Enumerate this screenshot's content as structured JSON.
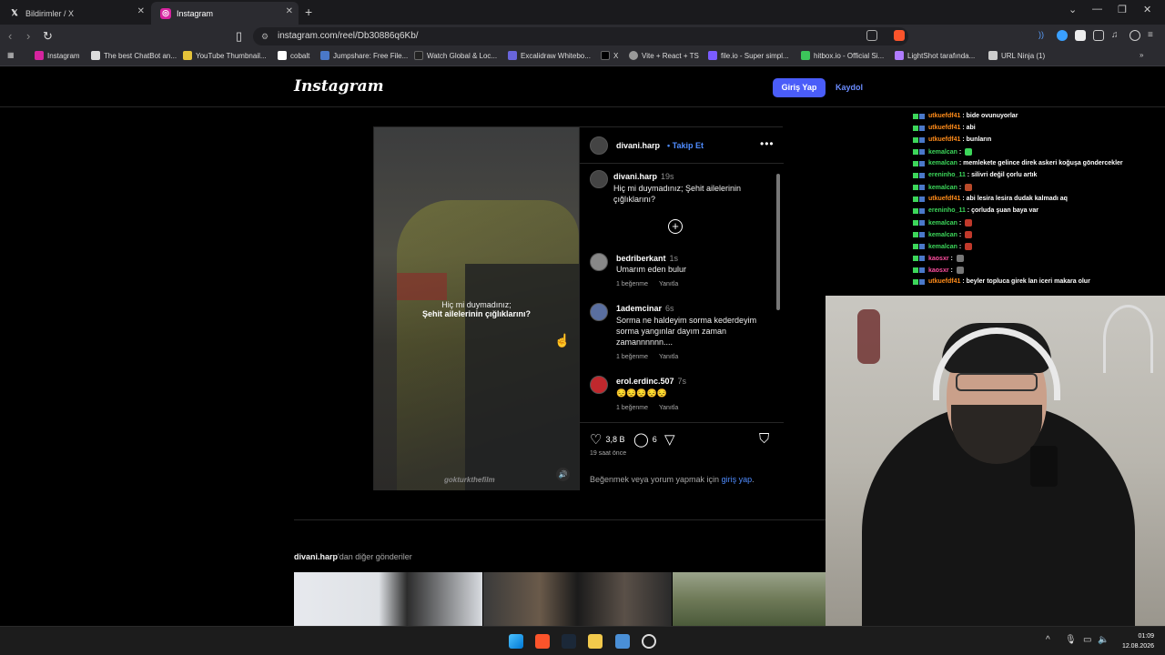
{
  "browser": {
    "tabs": [
      {
        "title": "Bildirimler / X",
        "icon": "x-logo-icon"
      },
      {
        "title": "Instagram",
        "icon": "instagram-icon",
        "active": true
      }
    ],
    "url": "instagram.com/reel/Db30886q6Kb/",
    "bookmarks": [
      {
        "label": "Instagram",
        "color": "#d6249f"
      },
      {
        "label": "The best ChatBot an...",
        "color": "#dddddd"
      },
      {
        "label": "YouTube Thumbnail...",
        "color": "#e5c33a"
      },
      {
        "label": "cobalt",
        "color": "#ffffff"
      },
      {
        "label": "Jumpshare: Free File...",
        "color": "#4a78c9"
      },
      {
        "label": "Watch Global & Loc...",
        "color": "#222222"
      },
      {
        "label": "Excalidraw Whitebo...",
        "color": "#6965db"
      },
      {
        "label": "X",
        "color": "#000000"
      },
      {
        "label": "Vite + React + TS",
        "color": "#999999"
      },
      {
        "label": "file.io - Super simpl...",
        "color": "#7a5cff"
      },
      {
        "label": "hitbox.io - Official Si...",
        "color": "#3cc45a"
      },
      {
        "label": "LightShot tarafında...",
        "color": "#b07cff"
      },
      {
        "label": "URL Ninja (1)",
        "color": "#cccccc"
      }
    ]
  },
  "header": {
    "logo": "Instagram",
    "login": "Giriş Yap",
    "signup": "Kaydol"
  },
  "post": {
    "author": "divani.harp",
    "follow": "Takip Et",
    "video_caption_line1": "Hiç mi duymadınız;",
    "video_caption_line2": "Şehit ailelerinin çığlıklarını?",
    "watermark": "gokturkthefilm",
    "caption": {
      "user": "divani.harp",
      "time": "19s",
      "text": "Hiç mi duymadınız; Şehit ailelerinin çığlıklarını?"
    },
    "comments": [
      {
        "user": "bedriberkant",
        "time": "1s",
        "text": "Umarım eden bulur",
        "likes": "1 beğenme",
        "reply": "Yanıtla"
      },
      {
        "user": "1ademcinar",
        "time": "6s",
        "text": "Sorma ne haldeyim sorma kederdeyim sorma yangınlar dayım zaman zamannnnnn....",
        "likes": "1 beğenme",
        "reply": "Yanıtla"
      },
      {
        "user": "erol.erdinc.507",
        "time": "7s",
        "text": "😔😔😔😔😔",
        "likes": "1 beğenme",
        "reply": "Yanıtla"
      }
    ],
    "like_count": "3,8 B",
    "comment_count": "6",
    "time_ago": "19 saat önce",
    "login_prompt": "Beğenmek veya yorum yapmak için ",
    "login_link": "giriş yap",
    "login_tail": "."
  },
  "more_posts": {
    "user": "divani.harp",
    "suffix": "'dan diğer gönderiler"
  },
  "chat": [
    {
      "user": "utkuefdf41",
      "color": "#ff8c1a",
      "text": "bide ovunuyorlar"
    },
    {
      "user": "utkuefdf41",
      "color": "#ff8c1a",
      "text": "abi"
    },
    {
      "user": "utkuefdf41",
      "color": "#ff8c1a",
      "text": "bunların"
    },
    {
      "user": "kemalcan",
      "color": "#3cd65a",
      "text": "",
      "emote": "#3cd65a"
    },
    {
      "user": "kemalcan",
      "color": "#3cd65a",
      "text": "memlekete gelince direk askeri koğuşa göndercekler"
    },
    {
      "user": "ereninho_11",
      "color": "#3cd65a",
      "text": "silivri değil çorlu artık"
    },
    {
      "user": "kemalcan",
      "color": "#3cd65a",
      "text": "",
      "emote": "#b84a2a"
    },
    {
      "user": "utkuefdf41",
      "color": "#ff8c1a",
      "text": "abi lesira lesira dudak kalmadı aq"
    },
    {
      "user": "ereninho_11",
      "color": "#3cd65a",
      "text": "çorluda şuan baya var"
    },
    {
      "user": "kemalcan",
      "color": "#3cd65a",
      "text": "",
      "emote": "#c0392b"
    },
    {
      "user": "kemalcan",
      "color": "#3cd65a",
      "text": "",
      "emote": "#c0392b"
    },
    {
      "user": "kemalcan",
      "color": "#3cd65a",
      "text": "",
      "emote": "#c0392b"
    },
    {
      "user": "kaosxr",
      "color": "#ff4fa0",
      "text": "",
      "emote": "#777777"
    },
    {
      "user": "kaosxr",
      "color": "#ff4fa0",
      "text": "",
      "emote": "#777777"
    },
    {
      "user": "utkuefdf41",
      "color": "#ff8c1a",
      "text": "beyler topluca girek lan iceri makara olur"
    }
  ],
  "taskbar": {
    "time": "01:09",
    "date": "12.08.2026"
  }
}
